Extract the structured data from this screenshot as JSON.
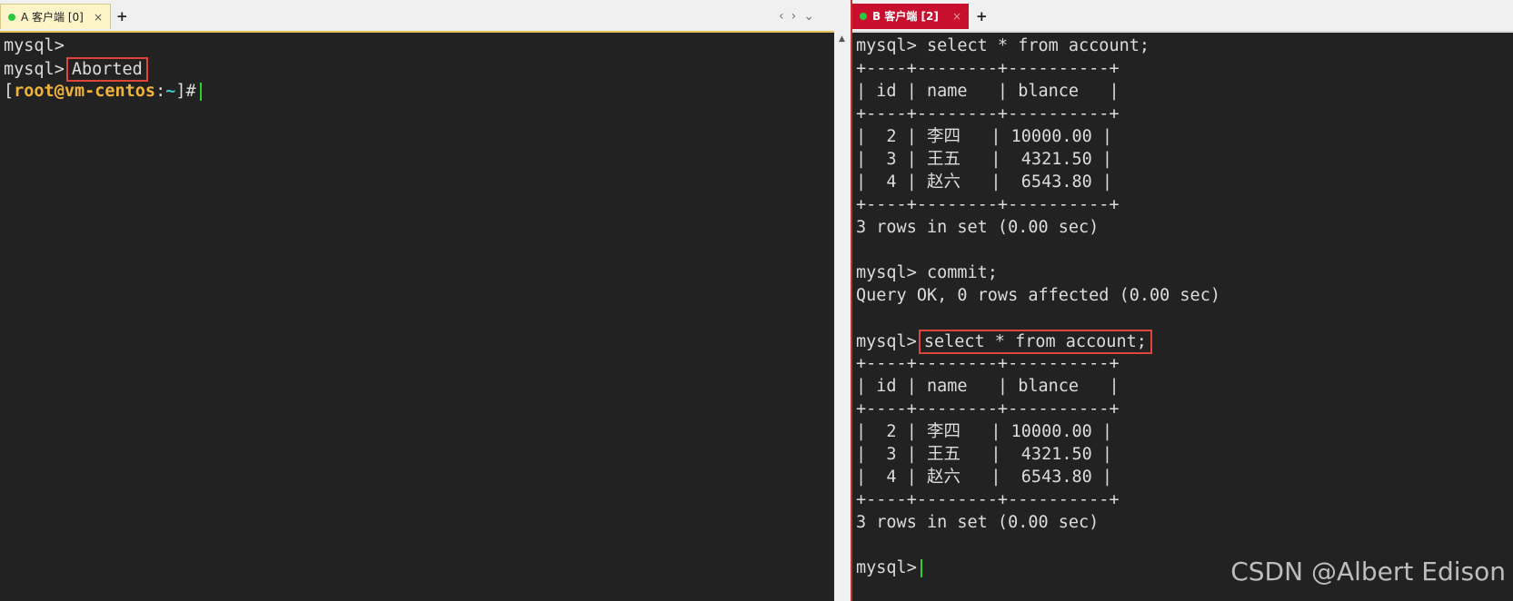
{
  "tab_a": {
    "label": "A 客户端 [0]",
    "close": "×",
    "add": "+"
  },
  "tab_b": {
    "label": "B 客户端 [2]",
    "close": "×",
    "add": "+"
  },
  "nav": {
    "prev": "‹",
    "next": "›",
    "menu": "⌄"
  },
  "terminal_a": {
    "line1": "mysql>",
    "line2_prompt": "mysql>",
    "line2_boxed": "Aborted",
    "shell_open": "[",
    "shell_user": "root@vm-centos",
    "shell_colon": ":",
    "shell_tilde": "~",
    "shell_close": "]#"
  },
  "terminal_b": {
    "lines": [
      "mysql> select * from account;",
      "+----+--------+----------+",
      "| id | name   | blance   |",
      "+----+--------+----------+",
      "|  2 | 李四   | 10000.00 |",
      "|  3 | 王五   |  4321.50 |",
      "|  4 | 赵六   |  6543.80 |",
      "+----+--------+----------+",
      "3 rows in set (0.00 sec)",
      "",
      "mysql> commit;",
      "Query OK, 0 rows affected (0.00 sec)",
      "",
      "mysql>",
      "+----+--------+----------+",
      "| id | name   | blance   |",
      "+----+--------+----------+",
      "|  2 | 李四   | 10000.00 |",
      "|  3 | 王五   |  4321.50 |",
      "|  4 | 赵六   |  6543.80 |",
      "+----+--------+----------+",
      "3 rows in set (0.00 sec)",
      "",
      "mysql>"
    ],
    "boxed_command": "select * from account;"
  },
  "watermark": "CSDN @Albert Edison",
  "colors": {
    "tab_b_bg": "#c8102e",
    "highlight_box": "#e0453a",
    "cursor": "#2ad22a",
    "prompt_user": "#f0b43c"
  }
}
